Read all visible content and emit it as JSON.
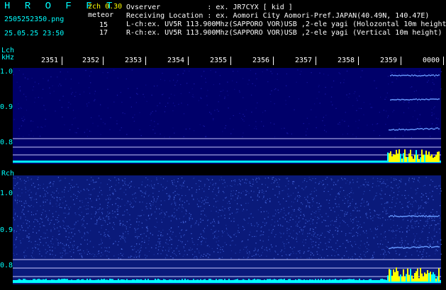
{
  "header": {
    "brand": "H R O F F T",
    "version": "2ch 0.30",
    "filename": "2505252350.png",
    "meteor_label": "meteor",
    "datetime": "25.05.25 23:50",
    "count_l": "15",
    "count_r": "17",
    "observer": "Ovserver           : ex. JR7CYX [ kid ]",
    "location": "Receiving Location : ex. Aomori City Aomori-Pref.JAPAN(40.49N, 140.47E)",
    "lch_desc": "L-ch:ex. UV5R 113.900Mhz(SAPPORO VOR)USB ,2-ele yagi (Holozontal 10m height)",
    "rch_desc": "R-ch:ex. UV5R 113.900Mhz(SAPPORO VOR)USB ,2-ele yagi (Vertical 10m height)"
  },
  "axes": {
    "lch_label": "Lch",
    "khz_label": "kHz",
    "rch_label": "Rch",
    "time_ticks": [
      "2351",
      "2352",
      "2353",
      "2354",
      "2355",
      "2356",
      "2357",
      "2358",
      "2359",
      "0000"
    ],
    "lch_freq_ticks": [
      "1.0",
      "0.9",
      "0.8"
    ],
    "rch_freq_ticks": [
      "1.0",
      "0.9",
      "0.8"
    ]
  },
  "colors": {
    "background": "#000000",
    "text": "#00ffff",
    "version": "#ffff00",
    "lch_plot": "#00006a",
    "rch_plot": "#0a1a7a",
    "trace": "#6699ff",
    "activity_high": "#ffff00",
    "activity_base": "#00ffff"
  }
}
